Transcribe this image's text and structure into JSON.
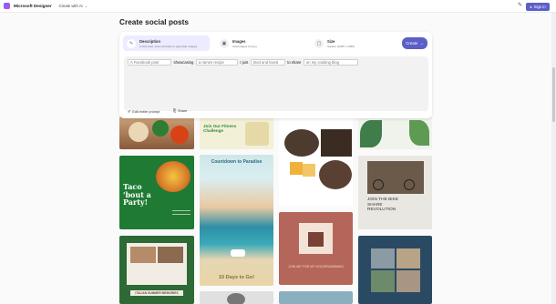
{
  "header": {
    "brand": "Microsoft Designer",
    "menu_label": "Create with AI",
    "signin_label": "Sign in"
  },
  "page": {
    "title": "Create social posts"
  },
  "tabs": [
    {
      "title": "Description",
      "subtitle": "In this post, enter prompts to generate images"
    },
    {
      "title": "Images",
      "subtitle": "Add images (if any)"
    },
    {
      "title": "Size",
      "subtitle": "Square (1080 x 1080)"
    }
  ],
  "create_label": "Create",
  "prompt": {
    "slot1": "A Facebook post",
    "word1": "showcasing",
    "slot2": "a ramen recipe",
    "word2": "I just",
    "slot3": "tried and loved",
    "word3": "to share",
    "slot4": "on my cooking blog"
  },
  "actions": {
    "edit": "Edit entire prompt",
    "share": "Share"
  },
  "cards": {
    "fitness": "Join Our Fitness Challenge",
    "taco": "Taco 'bout a Party!",
    "countdown": "Countdown to Paradise",
    "days": "10 Days to Go!",
    "bike": "JOIN THE BIKE SHARE REVOLUTION",
    "fireplace": "JOIN ME FOR MY HOUSEWARMING",
    "italian": "ITALIAN SUMMER MEMORIES"
  },
  "colors": {
    "accent": "#5b5fc7",
    "tab_active": "#ecebff"
  }
}
